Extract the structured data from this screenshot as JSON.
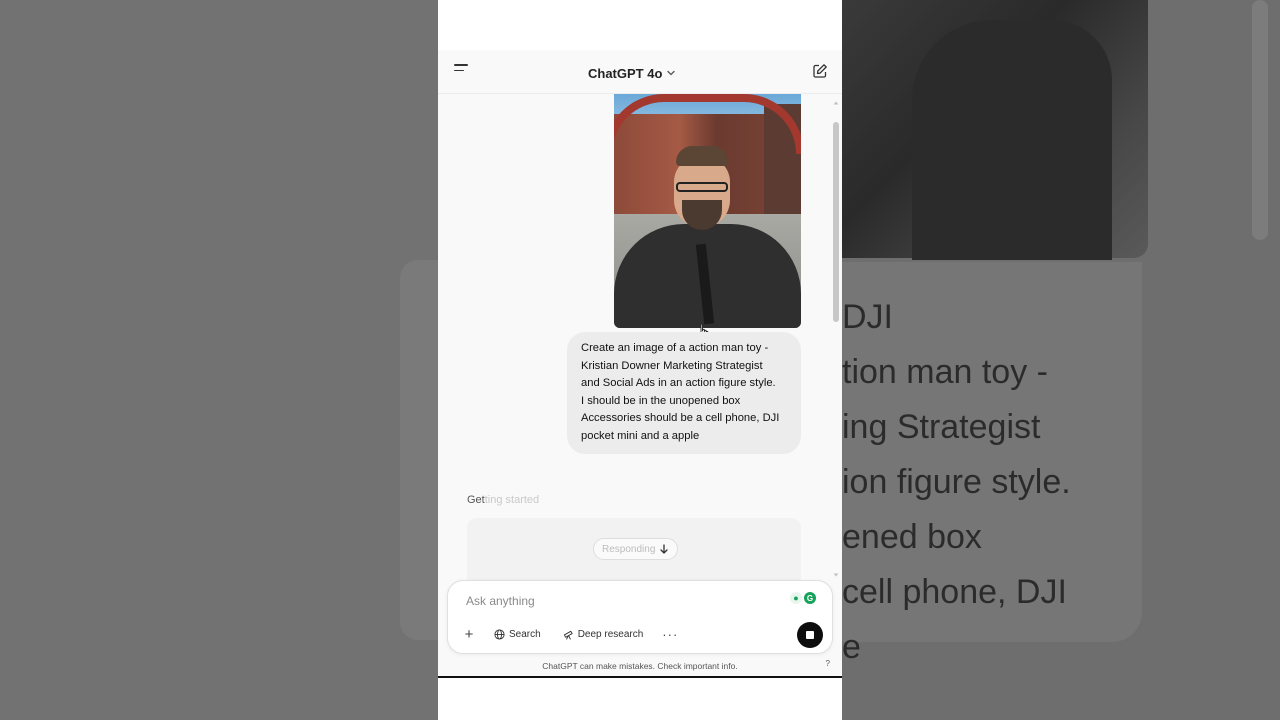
{
  "header": {
    "model_label": "ChatGPT 4o"
  },
  "conversation": {
    "user_message_lines": [
      "Create an image of a action man toy -",
      "Kristian Downer Marketing Strategist",
      "and Social Ads in an action figure style.",
      "I should be in the unopened box",
      "Accessories should be a cell phone, DJI",
      "pocket mini and a apple"
    ],
    "status_bright": "Get",
    "status_faded": "ting started",
    "responding_label": "Responding"
  },
  "composer": {
    "placeholder": "Ask anything",
    "search_label": "Search",
    "deep_research_label": "Deep research",
    "more_label": "···",
    "plus_label": "+"
  },
  "footer": {
    "disclaimer": "ChatGPT can make mistakes. Check important info.",
    "help": "?"
  },
  "background_zoom": {
    "text": "DJI\ntion man toy -\ning Strategist\nion figure style.\nened box\ncell phone, DJI\ne"
  },
  "colors": {
    "accent_grammarly": "#15a35b",
    "stop_button": "#0d0d0d",
    "bubble": "#ececec"
  }
}
